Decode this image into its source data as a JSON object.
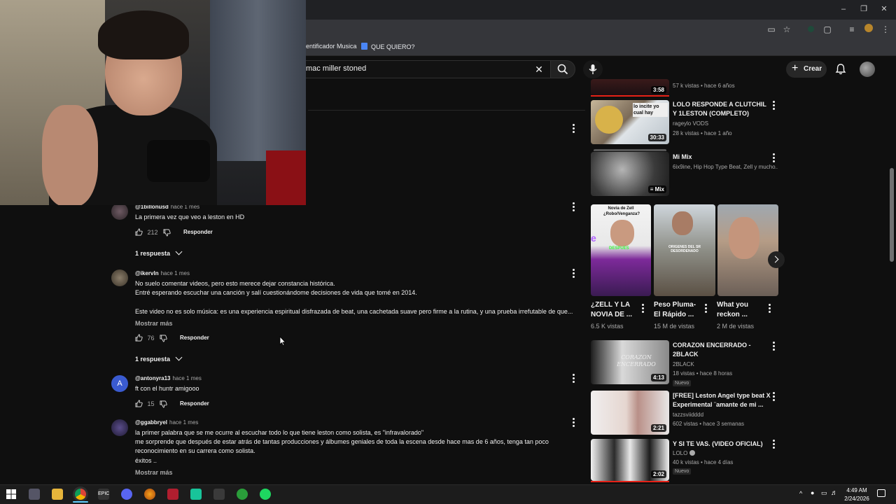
{
  "browser": {
    "bookmarks": [
      {
        "label": "dentificador Musica"
      },
      {
        "label": "QUE QUIERO?"
      }
    ]
  },
  "youtube_header": {
    "search_value": "mac miller stoned",
    "create_label": "Crear"
  },
  "comments": [
    {
      "author": "@1billonusd",
      "time": "hace 1 mes",
      "lines": [
        "La primera vez que veo a leston en HD"
      ],
      "likes": "212",
      "reply_label": "Responder",
      "replies_label": "1 respuesta"
    },
    {
      "author": "@ikervln",
      "time": "hace 1 mes",
      "lines": [
        "No suelo comentar videos, pero esto merece dejar constancia histórica.",
        "Entré esperando escuchar una canción y salí cuestionándome decisiones de vida que tomé en 2014.",
        "",
        "Este video no es solo música: es una experiencia espiritual disfrazada de beat, una cachetada suave pero firme a la rutina, y una prueba irrefutable de que..."
      ],
      "more_label": "Mostrar más",
      "likes": "76",
      "reply_label": "Responder",
      "replies_label": "1 respuesta"
    },
    {
      "author": "@antonyra13",
      "time": "hace 1 mes",
      "avatar_letter": "A",
      "lines": [
        "ft con el huntr amigooo"
      ],
      "likes": "15",
      "reply_label": "Responder"
    },
    {
      "author": "@ggabbryel",
      "time": "hace 1 mes",
      "lines": [
        "la primer palabra que se me ocurre al escuchar todo lo que tiene leston como solista, es \"infravalorado\"",
        "me sorprende que después de estar atrás de tantas producciones y álbumes geniales de toda la escena desde hace mas de 6 años, tenga tan poco",
        "reconocimiento en su carrera como solista.",
        "éxitos .."
      ],
      "more_label": "Mostrar más"
    }
  ],
  "sidebar": {
    "top_item": {
      "meta": "57 k vistas • hace 6 años",
      "duration": "3:58"
    },
    "videos": [
      {
        "title": "LOLO RESPONDE A CLUTCHIL Y 1LESTON (COMPLETO)",
        "channel": "rageylo VODS",
        "meta": "28 k vistas • hace 1 año",
        "duration": "30:33",
        "thumb_text": "lo incite yo cual hay"
      },
      {
        "title": "Mi Mix",
        "channel": "6ix9ine, Hip Hop Type Beat, Zell y mucho...",
        "meta": "",
        "duration": "Mix"
      }
    ],
    "shorts": [
      {
        "title": "¿ZELL Y LA NOVIA DE ...",
        "views": "6.5 K vistas",
        "thumb_top": "Novia de Zell ¿Robo/Venganza?",
        "thumb_tag": "DESPUES"
      },
      {
        "title": "Peso Pluma- El Rápido ...",
        "views": "15 M de vistas",
        "thumb_tag": "ORIGENES DEL SR DESORDENADO"
      },
      {
        "title": "What you reckon ...",
        "views": "2 M de vistas"
      }
    ],
    "videos2": [
      {
        "title": "CORAZON ENCERRADO - 2BLACK",
        "channel": "2BLACK",
        "meta": "18 vistas • hace 8 horas",
        "badge": "Nuevo",
        "duration": "4:13",
        "thumb_text": "CORAZON ENCERRADO"
      },
      {
        "title": "[FREE] Leston Angel type beat X Experimental ¨amante de mi ...",
        "channel": "tazzsviidddd",
        "meta": "602 vistas • hace 3 semanas",
        "duration": "2:21"
      },
      {
        "title": "Y SI TE VAS. (VIDEO OFICIAL)",
        "channel": "LOLO",
        "meta": "40 k vistas • hace 4 días",
        "badge": "Nuevo",
        "duration": "2:02"
      }
    ]
  },
  "taskbar": {
    "time": "4:49 AM",
    "date": "2/24/2026"
  },
  "colors": {
    "background": "#0f0f0f",
    "text": "#f1f1f1",
    "secondary_text": "#aaaaaa",
    "chrome_toolbar": "#35363a",
    "taskbar": "#1c1c1c"
  }
}
